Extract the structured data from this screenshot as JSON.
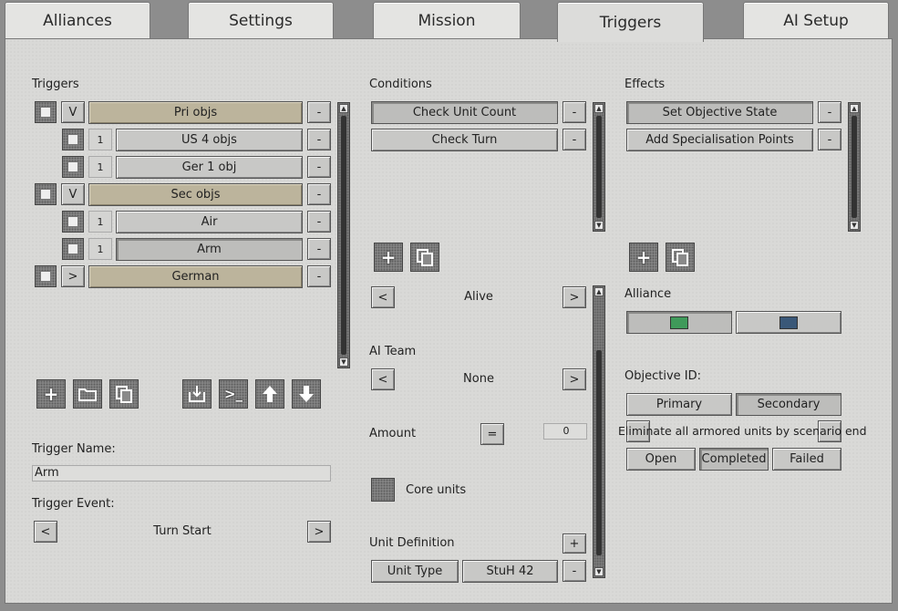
{
  "tabs": [
    "Alliances",
    "Settings",
    "Mission",
    "Triggers",
    "AI Setup"
  ],
  "triggers": {
    "heading": "Triggers",
    "rows": [
      {
        "toggle": "V",
        "label": "Pri objs",
        "group": true
      },
      {
        "toggle": "1",
        "label": "US 4 objs",
        "group": false
      },
      {
        "toggle": "1",
        "label": "Ger 1 obj",
        "group": false
      },
      {
        "toggle": "V",
        "label": "Sec objs",
        "group": true
      },
      {
        "toggle": "1",
        "label": "Air",
        "group": false
      },
      {
        "toggle": "1",
        "label": "Arm",
        "group": false
      },
      {
        "toggle": ">",
        "label": "German",
        "group": true
      }
    ],
    "remove_label": "-",
    "name_label": "Trigger Name:",
    "name_value": "Arm",
    "event_label": "Trigger Event:",
    "event_value": "Turn Start",
    "prev": "<",
    "next": ">"
  },
  "conditions": {
    "heading": "Conditions",
    "items": [
      "Check Unit Count",
      "Check Turn"
    ],
    "remove_label": "-",
    "state_value": "Alive",
    "ai_team_label": "AI Team",
    "ai_team_value": "None",
    "amount_label": "Amount",
    "amount_op": "=",
    "amount_value": "0",
    "core_units_label": "Core units",
    "unit_def_label": "Unit Definition",
    "add": "+",
    "unit_type_label": "Unit Type",
    "unit_type_value": "StuH 42",
    "prev": "<",
    "next": ">"
  },
  "effects": {
    "heading": "Effects",
    "items": [
      "Set Objective State",
      "Add Specialisation Points"
    ],
    "remove_label": "-",
    "alliance_label": "Alliance",
    "alliance_colors": [
      "#3f9a5a",
      "#3a5878"
    ],
    "objective_label": "Objective ID:",
    "objective_types": [
      "Primary",
      "Secondary"
    ],
    "objective_text": "Eliminate all armored units by scenario end",
    "states": [
      "Open",
      "Completed",
      "Failed"
    ]
  },
  "icons": {
    "add": "add-icon",
    "folder": "folder-icon",
    "copy": "copy-icon",
    "import": "import-icon",
    "console": "console-icon",
    "up": "arrow-up-icon",
    "down": "arrow-down-icon"
  }
}
